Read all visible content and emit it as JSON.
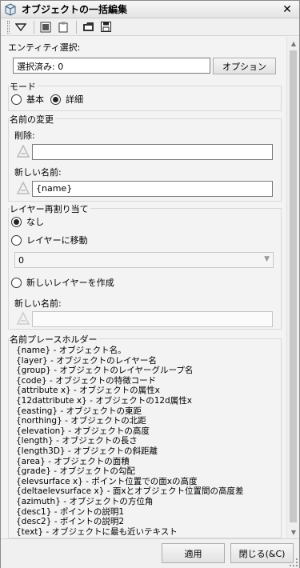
{
  "window": {
    "title": "オブジェクトの一括編集"
  },
  "toolbar": {
    "icons": [
      "filter-icon",
      "view-icon",
      "clipboard-icon",
      "folder-icon",
      "save-icon"
    ]
  },
  "entity": {
    "label": "エンティティ選択:",
    "value": "選択済み: 0",
    "option_button": "オプション"
  },
  "mode": {
    "title": "モード",
    "basic": "基本",
    "detail": "詳細",
    "selected": "detail"
  },
  "rename": {
    "title": "名前の変更",
    "delete_label": "削除:",
    "delete_value": "",
    "new_name_label": "新しい名前:",
    "new_name_value": "{name}"
  },
  "layer": {
    "title": "レイヤー再割り当て",
    "none": "なし",
    "move": "レイヤーに移動",
    "combo_value": "0",
    "create": "新しいレイヤーを作成",
    "new_name_label": "新しい名前:",
    "new_name_value": ""
  },
  "placeholders": {
    "title": "名前プレースホルダー",
    "items": [
      "{name} - オブジェクト名。",
      "{layer} - オブジェクトのレイヤー名",
      "{group} - オブジェクトのレイヤーグループ名",
      "{code} - オブジェクトの特徴コード",
      "{attribute x} - オブジェクトの属性x",
      "{12dattribute x} - オブジェクトの12d属性x",
      "{easting} - オブジェクトの東距",
      "{northing} - オブジェクトの北距",
      "{elevation} - オブジェクトの高度",
      "{length} - オブジェクトの長さ",
      "{length3D} - オブジェクトの斜距離",
      "{area} - オブジェクトの面積",
      "{grade} - オブジェクトの勾配",
      "{elevsurface x} - ポイント位置での面xの高度",
      "{deltaelevsurface x} - 面xとオブジェクト位置間の高度差",
      "{azimuth} - オブジェクトの方位角",
      "{desc1} - ポイントの説明1",
      "{desc2} - ポイントの説明2",
      "{text} - オブジェクトに最も近いテキスト"
    ]
  },
  "footer": {
    "apply": "適用",
    "close": "閉じる(&C)"
  }
}
